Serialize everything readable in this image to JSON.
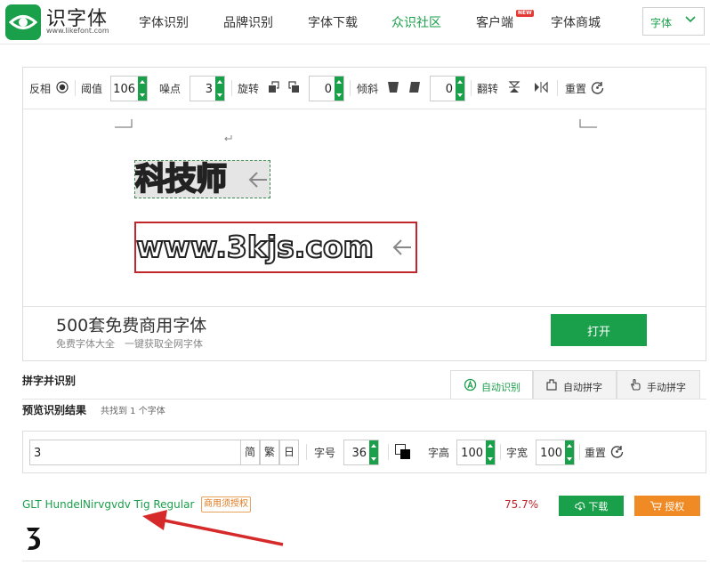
{
  "nav": {
    "logo_text": "识字体",
    "logo_url": "www.likefont.com",
    "items": [
      {
        "label": "字体识别"
      },
      {
        "label": "品牌识别"
      },
      {
        "label": "字体下载"
      },
      {
        "label": "众识社区"
      },
      {
        "label": "客户端"
      },
      {
        "label": "字体商城"
      }
    ],
    "new_badge": "NEW",
    "select_value": "字体"
  },
  "toolbar": {
    "invert_label": "反相",
    "threshold_label": "阈值",
    "threshold_value": "106",
    "noise_label": "噪点",
    "noise_value": "3",
    "rotate_label": "旋转",
    "rotate_value": "0",
    "skew_label": "倾斜",
    "skew_value": "0",
    "flip_label": "翻转",
    "reset_label": "重置"
  },
  "canvas": {
    "sample1_text": "科技师",
    "sample2_text": "www.3kjs.com"
  },
  "promo": {
    "title": "500套免费商用字体",
    "subtitle": "免费字体大全　一键获取全网字体",
    "button": "打开"
  },
  "recognition": {
    "title": "拼字并识别",
    "tabs": [
      {
        "label": "自动识别"
      },
      {
        "label": "自动拼字"
      },
      {
        "label": "手动拼字"
      }
    ],
    "result_title": "预览识别结果",
    "result_count": "共找到 1 个字体"
  },
  "filter": {
    "char_value": "3",
    "btn_simplified": "简",
    "btn_traditional": "繁",
    "btn_japanese": "日",
    "size_label": "字号",
    "size_value": "36",
    "height_label": "字高",
    "height_value": "100",
    "width_label": "字宽",
    "width_value": "100",
    "reset_label": "重置"
  },
  "result": {
    "font_name": "GLT HundelNirvgvdv Tig Regular",
    "license_tag": "商用须授权",
    "match": "75.7%",
    "download_label": "下载",
    "authorize_label": "授权",
    "preview_glyph": "3"
  },
  "colors": {
    "brand_green": "#1a9f4a",
    "accent_red": "#c0262b",
    "accent_orange": "#f08a24"
  }
}
